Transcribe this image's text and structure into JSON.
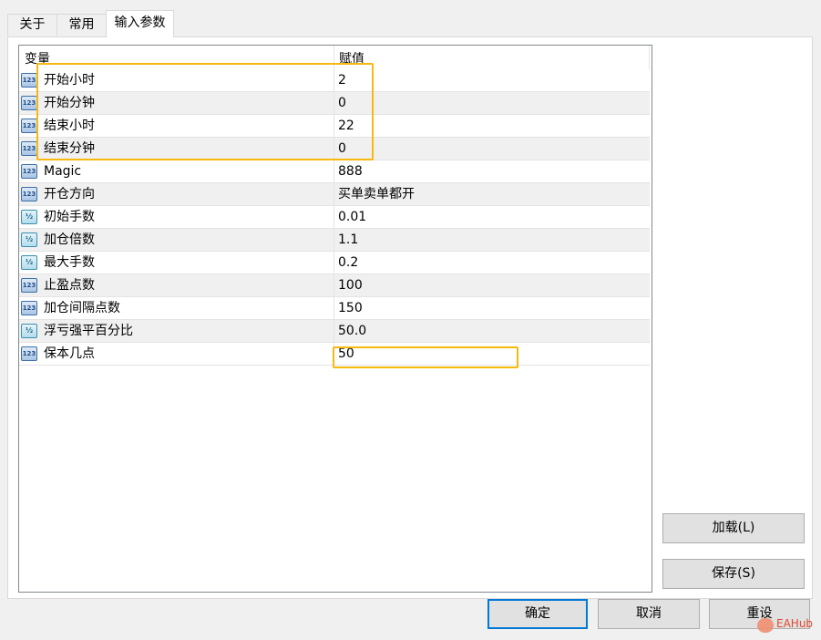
{
  "tabs": [
    "关于",
    "常用",
    "输入参数"
  ],
  "active_tab": "输入参数",
  "grid": {
    "columns": [
      "变量",
      "赋值"
    ],
    "rows": [
      {
        "icon": "integer-icon",
        "name": "开始小时",
        "value": "2"
      },
      {
        "icon": "integer-icon",
        "name": "开始分钟",
        "value": "0"
      },
      {
        "icon": "integer-icon",
        "name": "结束小时",
        "value": "22"
      },
      {
        "icon": "integer-icon",
        "name": "结束分钟",
        "value": "0"
      },
      {
        "icon": "integer-icon",
        "name": "Magic",
        "value": "888"
      },
      {
        "icon": "integer-icon",
        "name": "开仓方向",
        "value": "买单卖单都开"
      },
      {
        "icon": "double-icon",
        "name": "初始手数",
        "value": "0.01"
      },
      {
        "icon": "double-icon",
        "name": "加仓倍数",
        "value": "1.1"
      },
      {
        "icon": "double-icon",
        "name": "最大手数",
        "value": "0.2"
      },
      {
        "icon": "integer-icon",
        "name": "止盈点数",
        "value": "100"
      },
      {
        "icon": "integer-icon",
        "name": "加仓间隔点数",
        "value": "150"
      },
      {
        "icon": "double-icon",
        "name": "浮亏强平百分比",
        "value": "50.0"
      },
      {
        "icon": "integer-icon",
        "name": "保本几点",
        "value": "50"
      }
    ]
  },
  "side_buttons": {
    "load": "加载(L)",
    "save": "保存(S)"
  },
  "bottom_buttons": {
    "ok": "确定",
    "cancel": "取消",
    "reset": "重设"
  },
  "icon_glyphs": {
    "integer-icon": "123",
    "double-icon": "½"
  },
  "highlight_color": "#f5b90f",
  "watermark": "EAHub"
}
